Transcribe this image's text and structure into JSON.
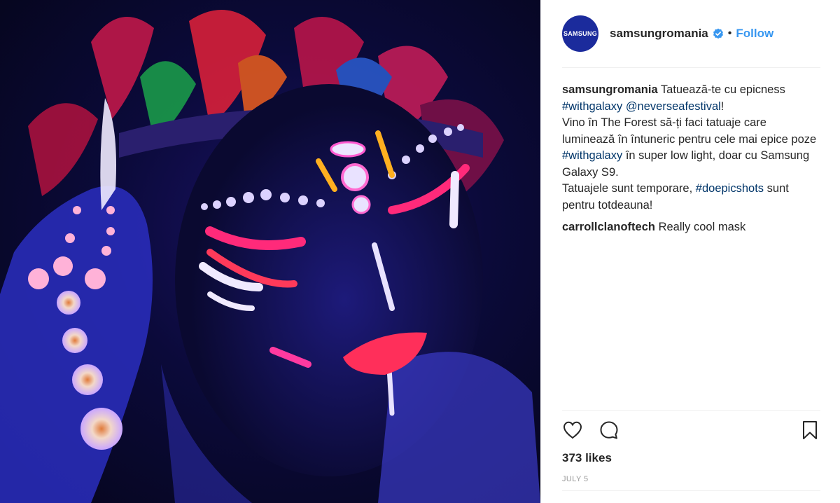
{
  "post": {
    "image_alt": "",
    "colors": {
      "link": "#003569",
      "follow": "#3897f0",
      "avatar_bg": "#1b2b9c",
      "verified": "#3897f0"
    }
  },
  "header": {
    "avatar_text": "SAMSUNG",
    "username": "samsungromania",
    "separator": "•",
    "follow_label": "Follow",
    "icons": {
      "verified": "verified-badge-icon"
    }
  },
  "caption": {
    "user": "samsungromania",
    "text1": "Tatuează-te cu epicness",
    "hashtag1": "#withgalaxy",
    "mention1": "@neverseafestival",
    "text2": "!",
    "text3": "Vino în The Forest să-ți faci tatuaje care luminează în întuneric pentru cele mai epice poze",
    "hashtag2": "#withgalaxy",
    "text4": "în super low light, doar cu Samsung Galaxy S9.",
    "text5": "Tatuajele sunt temporare,",
    "hashtag3": "#doepicshots",
    "text6": "sunt pentru totdeauna!"
  },
  "comments": [
    {
      "user": "carrollclanoftech",
      "text": "Really cool mask"
    }
  ],
  "actions": {
    "icons": {
      "like": "heart-icon",
      "comment": "comment-bubble-icon",
      "save": "bookmark-icon"
    }
  },
  "stats": {
    "likes": "373 likes",
    "date": "JULY 5"
  }
}
